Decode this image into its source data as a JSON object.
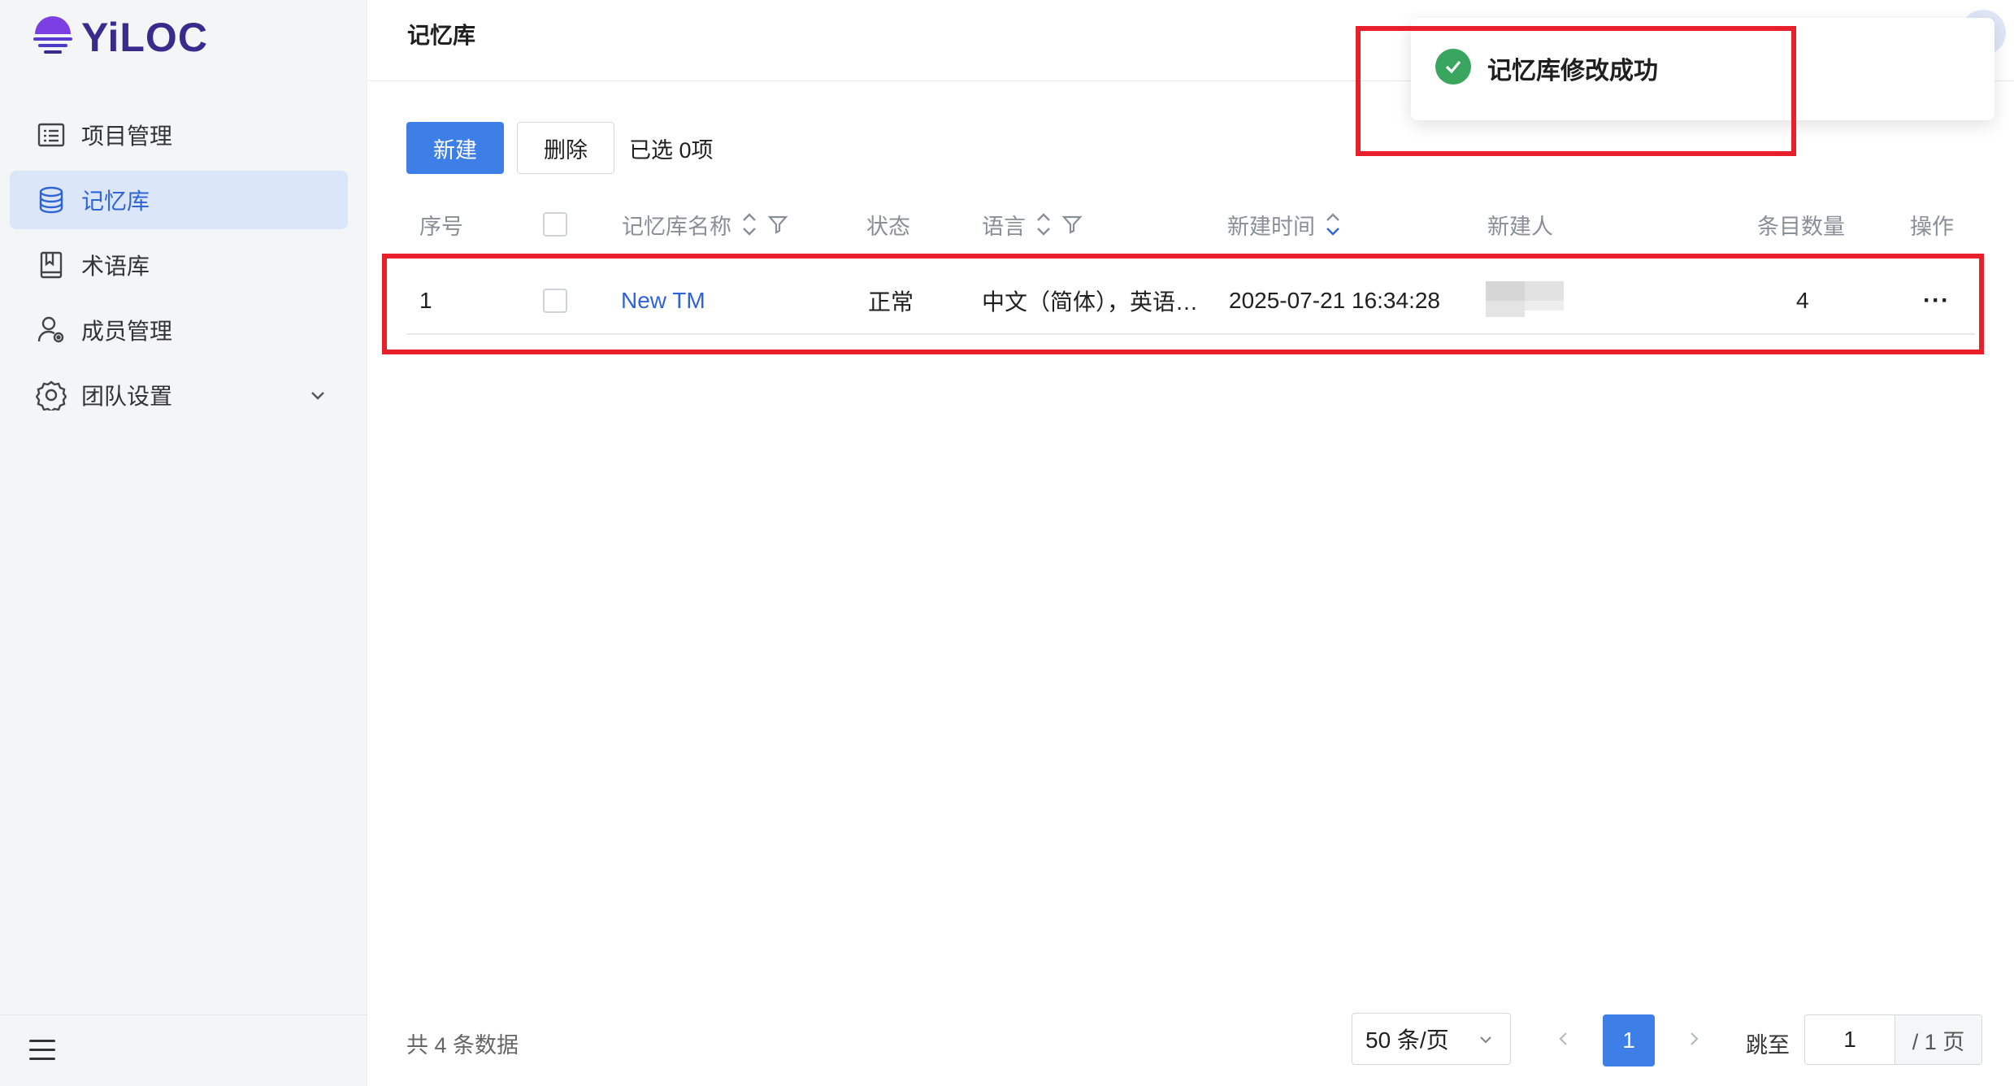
{
  "brand": {
    "name": "YiLOC",
    "accent": "#3a2a8c"
  },
  "sidebar": {
    "items": [
      {
        "label": "项目管理",
        "icon": "list-icon",
        "active": false
      },
      {
        "label": "记忆库",
        "icon": "database-icon",
        "active": true
      },
      {
        "label": "术语库",
        "icon": "book-icon",
        "active": false
      },
      {
        "label": "成员管理",
        "icon": "user-settings-icon",
        "active": false
      },
      {
        "label": "团队设置",
        "icon": "gear-icon",
        "active": false,
        "expandable": true
      }
    ]
  },
  "header": {
    "title": "记忆库"
  },
  "toolbar": {
    "new_label": "新建",
    "delete_label": "删除",
    "selected_text": "已选 0项"
  },
  "table": {
    "columns": [
      "序号",
      "记忆库名称",
      "状态",
      "语言",
      "新建时间",
      "新建人",
      "条目数量",
      "操作"
    ],
    "rows": [
      {
        "index": "1",
        "name": "New TM",
        "status": "正常",
        "language": "中文（简体），英语…",
        "created_at": "2025-07-21 16:34:28",
        "creator": "",
        "count": "4",
        "action": "···"
      }
    ]
  },
  "toast": {
    "message": "记忆库修改成功",
    "type": "success"
  },
  "pagination": {
    "total_text": "共 4 条数据",
    "page_size": "50 条/页",
    "current_page": "1",
    "jump_label": "跳至",
    "jump_value": "1",
    "total_pages_text": "/ 1 页"
  },
  "colors": {
    "primary": "#3d7fe6",
    "link": "#2f64d6",
    "success": "#3aa55f",
    "annotation": "#e8202b"
  }
}
